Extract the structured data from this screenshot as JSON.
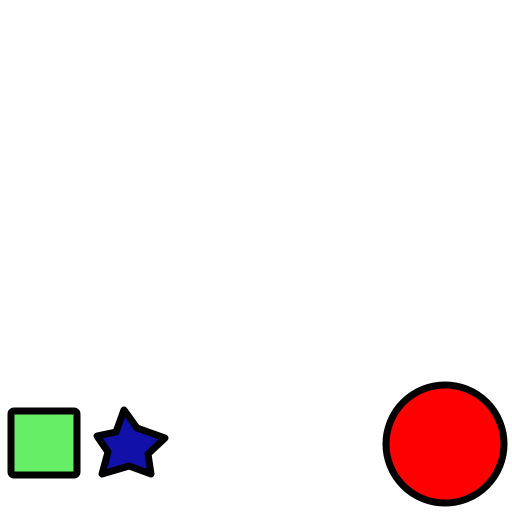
{
  "scene": {
    "background": "#ffffff",
    "outline_color": "#000000",
    "shapes": [
      {
        "kind": "square",
        "fill": "#66ee66",
        "icon": "green-square"
      },
      {
        "kind": "star",
        "fill": "#1111aa",
        "icon": "blue-star"
      },
      {
        "kind": "circle",
        "fill": "#ff0000",
        "icon": "red-circle"
      }
    ]
  }
}
